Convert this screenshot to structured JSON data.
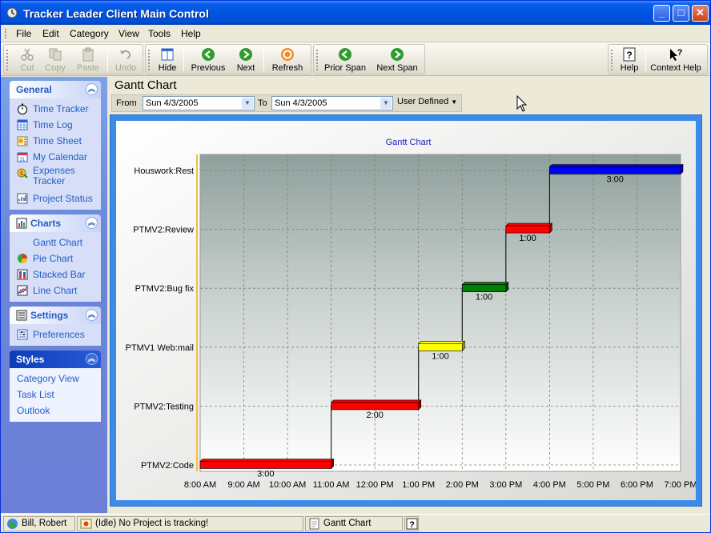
{
  "window": {
    "title": "Tracker Leader Client Main Control",
    "controls": {
      "minimize": "_",
      "maximize": "□",
      "close": "✕"
    }
  },
  "menu": [
    "File",
    "Edit",
    "Category",
    "View",
    "Tools",
    "Help"
  ],
  "toolbar": {
    "cut": "Cut",
    "copy": "Copy",
    "paste": "Paste",
    "undo": "Undo",
    "hide": "Hide",
    "previous": "Previous",
    "next": "Next",
    "refresh": "Refresh",
    "prior_span": "Prior Span",
    "next_span": "Next Span",
    "help": "Help",
    "context_help": "Context Help"
  },
  "sidebar": {
    "general": {
      "title": "General",
      "items": [
        "Time Tracker",
        "Time Log",
        "Time Sheet",
        "My Calendar",
        "Expenses Tracker",
        "Project Status"
      ]
    },
    "charts": {
      "title": "Charts",
      "items": [
        "Gantt Chart",
        "Pie Chart",
        "Stacked Bar",
        "Line Chart"
      ]
    },
    "settings": {
      "title": "Settings",
      "items": [
        "Preferences"
      ]
    },
    "styles": {
      "title": "Styles",
      "items": [
        "Category View",
        "Task List",
        "Outlook"
      ]
    }
  },
  "main": {
    "heading": "Gantt Chart",
    "range": {
      "from_label": "From",
      "from_value": "Sun 4/3/2005",
      "to_label": "To",
      "to_value": "Sun 4/3/2005",
      "mode": "User Defined"
    }
  },
  "chart_data": {
    "type": "gantt",
    "title": "Gantt Chart",
    "x_ticks": [
      "8:00 AM",
      "9:00 AM",
      "10:00 AM",
      "11:00 AM",
      "12:00 PM",
      "1:00 PM",
      "2:00 PM",
      "3:00 PM",
      "4:00 PM",
      "5:00 PM",
      "6:00 PM",
      "7:00 PM"
    ],
    "categories": [
      "PTMV2:Code",
      "PTMV2:Testing",
      "PTMV1 Web:mail",
      "PTMV2:Bug fix",
      "PTMV2:Review",
      "Houswork:Rest"
    ],
    "tasks": [
      {
        "category": "PTMV2:Code",
        "start": "8:00 AM",
        "end": "11:00 AM",
        "label": "3:00",
        "color": "#ff0000"
      },
      {
        "category": "PTMV2:Testing",
        "start": "11:00 AM",
        "end": "1:00 PM",
        "label": "2:00",
        "color": "#ff0000"
      },
      {
        "category": "PTMV1 Web:mail",
        "start": "1:00 PM",
        "end": "2:00 PM",
        "label": "1:00",
        "color": "#ffff00"
      },
      {
        "category": "PTMV2:Bug fix",
        "start": "2:00 PM",
        "end": "3:00 PM",
        "label": "1:00",
        "color": "#008000"
      },
      {
        "category": "PTMV2:Review",
        "start": "3:00 PM",
        "end": "4:00 PM",
        "label": "1:00",
        "color": "#ff0000"
      },
      {
        "category": "Houswork:Rest",
        "start": "4:00 PM",
        "end": "7:00 PM",
        "label": "3:00",
        "color": "#0000ff"
      }
    ]
  },
  "status": {
    "user": "Bill, Robert",
    "tracking": "(Idle) No Project is tracking!",
    "view": "Gantt Chart"
  }
}
